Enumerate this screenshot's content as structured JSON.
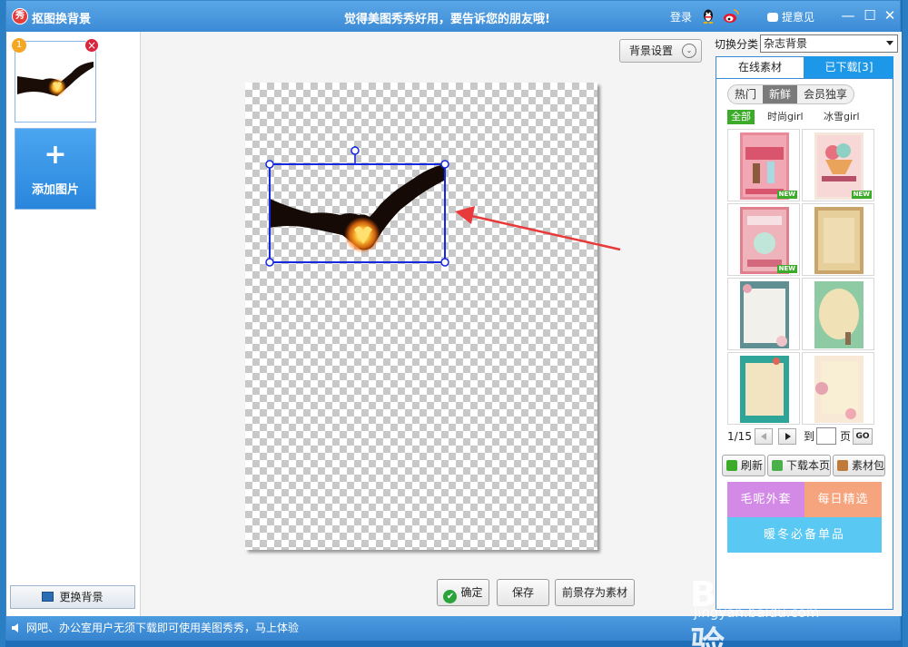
{
  "window": {
    "title": "抠图换背景",
    "logo_char": "秀",
    "slogan": "觉得美图秀秀好用，要告诉您的朋友哦!",
    "login": "登录",
    "feedback": "提意见",
    "min_glyph": "—",
    "max_glyph": "☐",
    "close_glyph": "✕"
  },
  "left_panel": {
    "thumb_index": "1",
    "thumb_close_glyph": "×",
    "add_plus": "+",
    "add_label": "添加图片",
    "change_bg_label": "更换背景"
  },
  "canvas_area": {
    "bg_settings_label": "背景设置",
    "bg_settings_chevron": "⌄"
  },
  "footer_buttons": {
    "ok_label": "确定",
    "ok_glyph": "✔",
    "save_label": "保存",
    "save_as_label": "前景存为素材"
  },
  "right_panel": {
    "switch_label": "切换分类",
    "switch_value": "杂志背景",
    "tabs": [
      {
        "label": "在线素材",
        "active": true
      },
      {
        "label": "已下载[3]",
        "active": false
      }
    ],
    "subtabs": [
      {
        "label": "热门",
        "active": false
      },
      {
        "label": "新鲜",
        "active": true
      },
      {
        "label": "会员独享",
        "active": false
      }
    ],
    "filters": {
      "all": "全部",
      "fashion": "时尚girl",
      "ice": "冰雪girl"
    },
    "tiles": [
      {
        "name": "ice-cream-pink",
        "new": true
      },
      {
        "name": "ice-cream-cup",
        "new": true
      },
      {
        "name": "delicious-pink",
        "new": true
      },
      {
        "name": "vintage-kraft",
        "new": false
      },
      {
        "name": "teal-floral",
        "new": false
      },
      {
        "name": "green-oval",
        "new": false
      },
      {
        "name": "teal-frame",
        "new": false
      },
      {
        "name": "floral-paper",
        "new": false
      }
    ],
    "new_badge": "NEW",
    "pager": {
      "page": "1/15",
      "to": "到",
      "unit": "页",
      "go": "GO",
      "input_value": ""
    },
    "actions": {
      "refresh": "刷新",
      "download_page": "下载本页",
      "pack": "素材包"
    },
    "promo": {
      "a": "毛呢外套",
      "b": "每日精选",
      "c": "暖冬必备单品"
    }
  },
  "statusbar": {
    "text": "网吧、办公室用户无须下载即可使用美图秀秀，马上体验"
  },
  "watermark": {
    "brand": "Baidu经验",
    "url": "jingyan.baidu.com"
  },
  "colors": {
    "title_bar": "#3b8ad6",
    "accent_blue": "#1d97e8",
    "selection_box": "#1428e0",
    "arrow": "#e83a3a",
    "new_green": "#3cab2a"
  }
}
